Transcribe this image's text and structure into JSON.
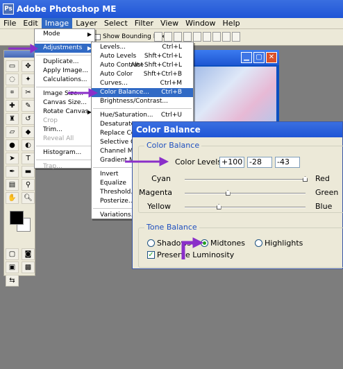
{
  "app": {
    "title": "Adobe Photoshop ME",
    "icon": "photoshop-icon"
  },
  "menubar": [
    "File",
    "Edit",
    "Image",
    "Layer",
    "Select",
    "Filter",
    "View",
    "Window",
    "Help"
  ],
  "options": {
    "show_bounding_box": "Show Bounding Box"
  },
  "image_menu": [
    {
      "label": "Mode",
      "submenu": true
    },
    {
      "sep": true
    },
    {
      "label": "Adjustments",
      "submenu": true,
      "highlight": true
    },
    {
      "sep": true
    },
    {
      "label": "Duplicate..."
    },
    {
      "label": "Apply Image..."
    },
    {
      "label": "Calculations..."
    },
    {
      "sep": true
    },
    {
      "label": "Image Size..."
    },
    {
      "label": "Canvas Size..."
    },
    {
      "label": "Rotate Canvas",
      "submenu": true
    },
    {
      "label": "Crop",
      "disabled": true
    },
    {
      "label": "Trim..."
    },
    {
      "label": "Reveal All",
      "disabled": true
    },
    {
      "sep": true
    },
    {
      "label": "Histogram..."
    },
    {
      "sep": true
    },
    {
      "label": "Trap...",
      "disabled": true
    }
  ],
  "adjust_menu": [
    {
      "label": "Levels...",
      "shortcut": "Ctrl+L"
    },
    {
      "label": "Auto Levels",
      "shortcut": "Shft+Ctrl+L"
    },
    {
      "label": "Auto Contrast",
      "shortcut": "Alt+Shft+Ctrl+L"
    },
    {
      "label": "Auto Color",
      "shortcut": "Shft+Ctrl+B"
    },
    {
      "label": "Curves...",
      "shortcut": "Ctrl+M"
    },
    {
      "label": "Color Balance...",
      "shortcut": "Ctrl+B",
      "highlight": true
    },
    {
      "label": "Brightness/Contrast..."
    },
    {
      "sep": true
    },
    {
      "label": "Hue/Saturation...",
      "shortcut": "Ctrl+U"
    },
    {
      "label": "Desaturate"
    },
    {
      "label": "Replace Colo"
    },
    {
      "label": "Selective Co"
    },
    {
      "label": "Channel Mixe"
    },
    {
      "label": "Gradient Ma"
    },
    {
      "sep": true
    },
    {
      "label": "Invert"
    },
    {
      "label": "Equalize"
    },
    {
      "label": "Threshold..."
    },
    {
      "label": "Posterize..."
    },
    {
      "sep": true
    },
    {
      "label": "Variations..."
    }
  ],
  "dialog": {
    "title": "Color Balance",
    "group_color": "Color Balance",
    "color_levels_label": "Color Levels:",
    "levels": [
      "+100",
      "-28",
      "-43"
    ],
    "sliders": [
      {
        "left": "Cyan",
        "right": "Red",
        "value": 100
      },
      {
        "left": "Magenta",
        "right": "Green",
        "value": -28
      },
      {
        "left": "Yellow",
        "right": "Blue",
        "value": -43
      }
    ],
    "group_tone": "Tone Balance",
    "tones": [
      "Shadows",
      "Midtones",
      "Highlights"
    ],
    "selected_tone": "Midtones",
    "preserve_luminosity": "Preserve Luminosity",
    "preserve_checked": true
  },
  "colors": {
    "accent": "#316ac5",
    "arrow": "#8a2fc9",
    "title": "#1f55d6"
  }
}
